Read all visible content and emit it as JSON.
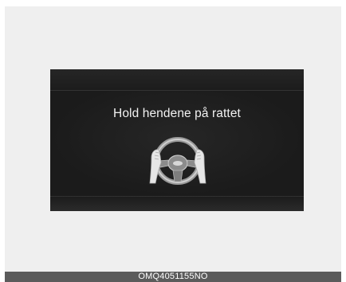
{
  "display": {
    "message": "Hold hendene på rattet"
  },
  "caption": {
    "code": "OMQ4051155NO"
  },
  "icons": {
    "wheel": "steering-wheel-hands-icon"
  },
  "colors": {
    "background": "#efefef",
    "display_bg": "#1f1f1f",
    "message_text": "#f2f2f2",
    "caption_bar": "#5b5b5b"
  }
}
